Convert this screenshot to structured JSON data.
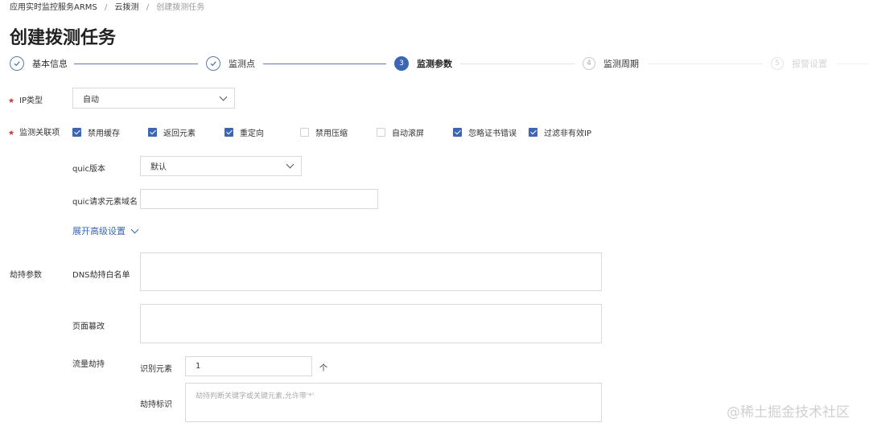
{
  "breadcrumb": [
    "应用实时监控服务ARMS",
    "云拨测",
    "创建拨测任务"
  ],
  "breadcrumb_sep": "/",
  "page_title": "创建拨测任务",
  "steps": [
    {
      "index": "1",
      "label": "基本信息",
      "status": "done"
    },
    {
      "index": "2",
      "label": "监测点",
      "status": "done"
    },
    {
      "index": "3",
      "label": "监测参数",
      "status": "active"
    },
    {
      "index": "4",
      "label": "监测周期",
      "status": "todo"
    },
    {
      "index": "5",
      "label": "报警设置",
      "status": "todo"
    }
  ],
  "form": {
    "ip_type": {
      "label": "IP类型",
      "value": "自动",
      "required": true
    },
    "monitor_options": {
      "label": "监测关联项",
      "required": true,
      "options": [
        {
          "label": "禁用缓存",
          "checked": true
        },
        {
          "label": "返回元素",
          "checked": true
        },
        {
          "label": "重定向",
          "checked": true
        },
        {
          "label": "禁用压缩",
          "checked": false
        },
        {
          "label": "自动滚屏",
          "checked": false
        },
        {
          "label": "忽略证书错误",
          "checked": true
        },
        {
          "label": "过滤非有效IP",
          "checked": true
        }
      ]
    },
    "quic_version": {
      "label": "quic版本",
      "value": "默认"
    },
    "quic_domain": {
      "label": "quic请求元素域名",
      "value": ""
    },
    "advanced_link": "展开高级设置",
    "hijack": {
      "label": "劫持参数",
      "dns_whitelist": {
        "label": "DNS劫持白名单",
        "value": ""
      },
      "page_tamper": {
        "label": "页面篡改",
        "value": ""
      },
      "traffic_hijack": {
        "label": "流量劫持",
        "identify_elements": {
          "label": "识别元素",
          "value": "1",
          "unit": "个"
        },
        "hijack_mark": {
          "label": "劫持标识",
          "placeholder": "劫持判断关键字或关键元素,允许带'*'"
        }
      }
    }
  },
  "watermark": "@稀土掘金技术社区",
  "colors": {
    "accent": "#3b66b5",
    "required": "#d0313b",
    "border": "#d9d9d9"
  }
}
